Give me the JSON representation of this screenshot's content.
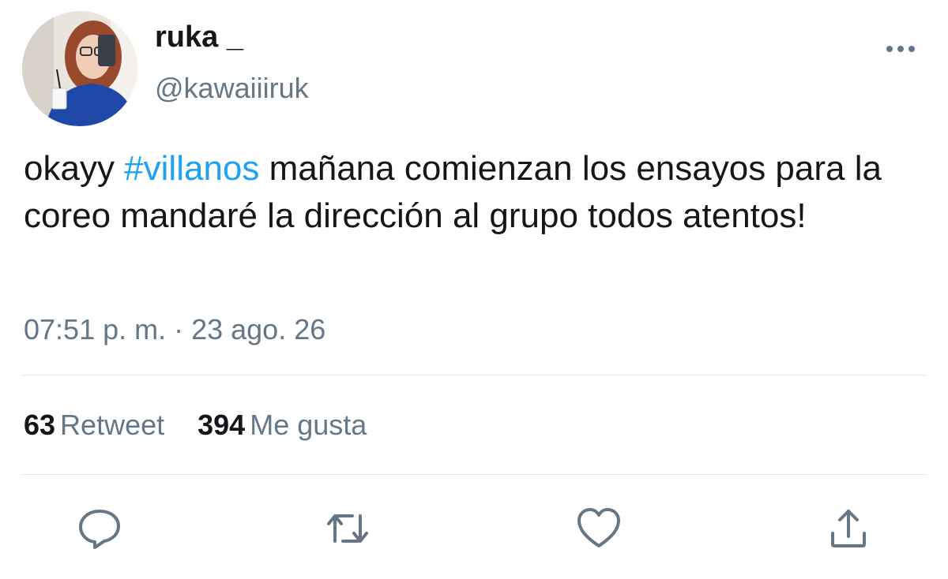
{
  "user": {
    "display_name": "ruka _",
    "handle": "@kawaiiiruk"
  },
  "tweet": {
    "text_before": "okayy ",
    "hashtag": "#villanos",
    "text_after": " mañana comienzan los ensayos para la coreo mandaré la dirección al grupo todos atentos!",
    "timestamp": "07:51 p. m. · 23 ago. 26"
  },
  "stats": {
    "retweet_count": "63",
    "retweet_label": "Retweet",
    "like_count": "394",
    "like_label": "Me gusta"
  },
  "icons": {
    "more": "more-icon",
    "reply": "reply-icon",
    "retweet": "retweet-icon",
    "like": "heart-icon",
    "share": "share-icon"
  },
  "colors": {
    "hashtag": "#1da1f2",
    "secondary_text": "#657786",
    "primary_text": "#14171a",
    "divider": "#e1e8ed"
  }
}
